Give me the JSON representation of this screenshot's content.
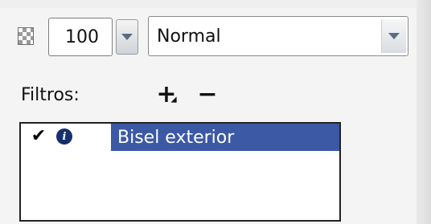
{
  "layer_options": {
    "opacity_value": "100",
    "blend_mode": "Normal"
  },
  "filters": {
    "label": "Filtros:",
    "add_symbol": "+",
    "remove_symbol": "−",
    "items": [
      {
        "name": "Bisel exterior",
        "enabled": true
      }
    ]
  },
  "icons": {
    "transparency": "transparency-swatch-icon",
    "dropdown": "chevron-down-icon",
    "add": "plus-icon",
    "remove": "minus-icon",
    "check": "checkmark-icon",
    "info": "info-icon"
  },
  "colors": {
    "selection": "#3c59a6",
    "info_icon": "#16306b",
    "panel_bg": "#f4f4f4"
  }
}
